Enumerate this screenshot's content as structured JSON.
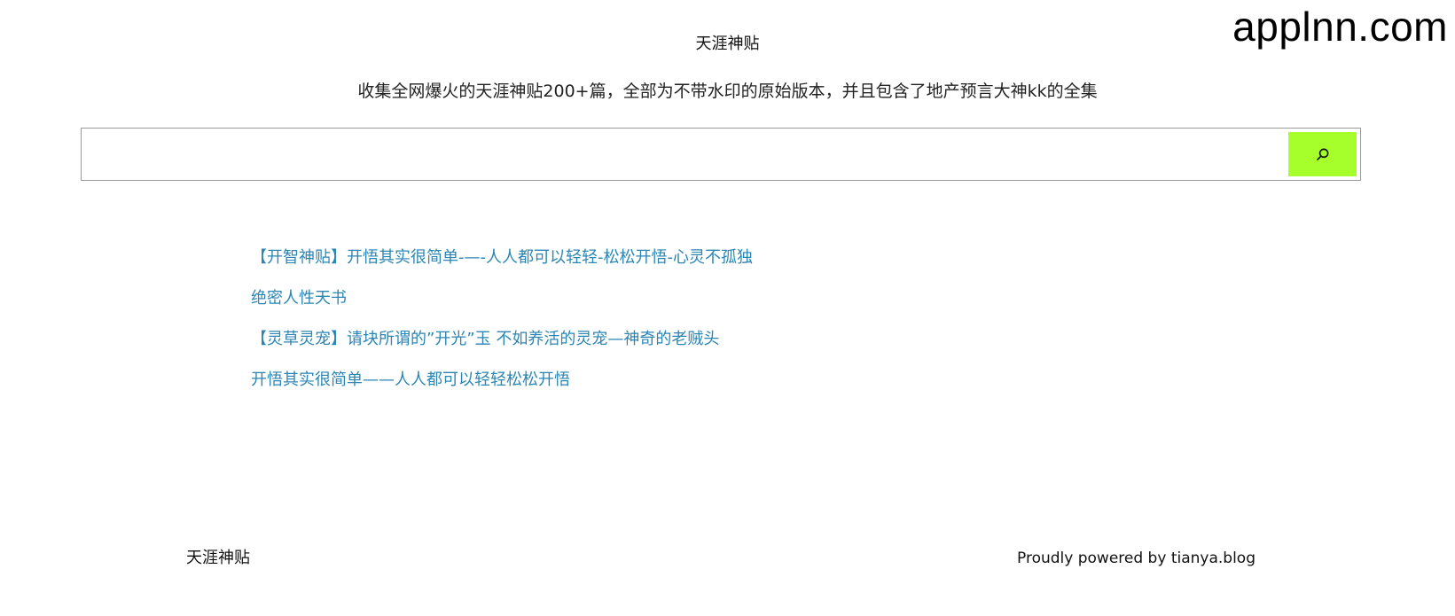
{
  "watermark": {
    "text": "applnn.com"
  },
  "header": {
    "site_title": "天涯神贴",
    "description": "收集全网爆火的天涯神贴200+篇，全部为不带水印的原始版本，并且包含了地产预言大神kk的全集"
  },
  "search": {
    "value": "",
    "placeholder": "",
    "button_icon": "search-icon",
    "button_color": "#a6ff2a"
  },
  "posts": [
    {
      "title": "【开智神贴】开悟其实很简单-—-人人都可以轻轻-松松开悟-心灵不孤独"
    },
    {
      "title": "绝密人性天书"
    },
    {
      "title": "【灵草灵宠】请块所谓的”开光”玉 不如养活的灵宠—神奇的老贼头"
    },
    {
      "title": "开悟其实很简单——人人都可以轻轻松松开悟"
    }
  ],
  "footer": {
    "site_name": "天涯神贴",
    "powered_by": "Proudly powered by tianya.blog"
  },
  "colors": {
    "link": "#2b86b3",
    "accent": "#a6ff2a"
  }
}
